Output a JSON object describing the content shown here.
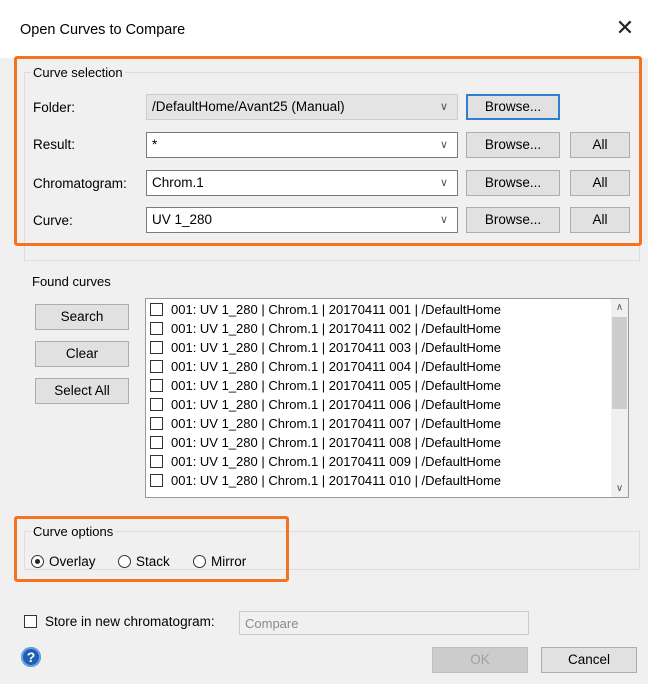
{
  "window": {
    "title": "Open Curves to Compare",
    "close_glyph": "✕"
  },
  "curve_selection": {
    "legend": "Curve selection",
    "folder": {
      "label": "Folder:",
      "value": "/DefaultHome/Avant25 (Manual)",
      "browse": "Browse..."
    },
    "result": {
      "label": "Result:",
      "value": "*",
      "browse": "Browse...",
      "all": "All"
    },
    "chromatogram": {
      "label": "Chromatogram:",
      "value": "Chrom.1",
      "browse": "Browse...",
      "all": "All"
    },
    "curve": {
      "label": "Curve:",
      "value": "UV 1_280",
      "browse": "Browse...",
      "all": "All"
    }
  },
  "found_curves": {
    "legend": "Found curves",
    "search": "Search",
    "clear": "Clear",
    "select_all": "Select All",
    "items": [
      "001: UV 1_280 | Chrom.1 | 20170411 001 | /DefaultHome",
      "001: UV 1_280 | Chrom.1 | 20170411 002 | /DefaultHome",
      "001: UV 1_280 | Chrom.1 | 20170411 003 | /DefaultHome",
      "001: UV 1_280 | Chrom.1 | 20170411 004 | /DefaultHome",
      "001: UV 1_280 | Chrom.1 | 20170411 005 | /DefaultHome",
      "001: UV 1_280 | Chrom.1 | 20170411 006 | /DefaultHome",
      "001: UV 1_280 | Chrom.1 | 20170411 007 | /DefaultHome",
      "001: UV 1_280 | Chrom.1 | 20170411 008 | /DefaultHome",
      "001: UV 1_280 | Chrom.1 | 20170411 009 | /DefaultHome",
      "001: UV 1_280 | Chrom.1 | 20170411 010 | /DefaultHome"
    ]
  },
  "curve_options": {
    "legend": "Curve options",
    "overlay": "Overlay",
    "stack": "Stack",
    "mirror": "Mirror",
    "selected": "Overlay"
  },
  "store": {
    "label": "Store in new chromatogram:",
    "placeholder": "Compare",
    "checked": false
  },
  "footer": {
    "ok": "OK",
    "cancel": "Cancel",
    "help_glyph": "?"
  },
  "colors": {
    "highlight": "#f4731f",
    "focus": "#2d7fd1"
  }
}
